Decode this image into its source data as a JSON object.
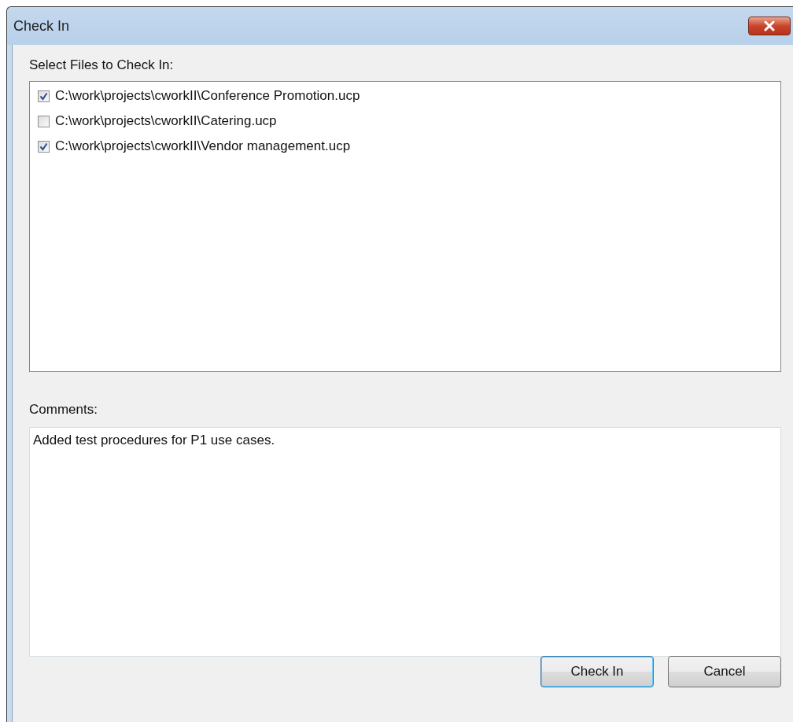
{
  "window": {
    "title": "Check In"
  },
  "files_label": "Select Files to Check In:",
  "files": [
    {
      "path": "C:\\work\\projects\\cworkII\\Conference Promotion.ucp",
      "checked": true
    },
    {
      "path": "C:\\work\\projects\\cworkII\\Catering.ucp",
      "checked": false
    },
    {
      "path": "C:\\work\\projects\\cworkII\\Vendor management.ucp",
      "checked": true
    }
  ],
  "comments_label": "Comments:",
  "comments": "Added test procedures for P1 use cases.",
  "buttons": [
    {
      "label": "Check In",
      "kind": "default"
    },
    {
      "label": "Cancel",
      "kind": "normal"
    }
  ]
}
